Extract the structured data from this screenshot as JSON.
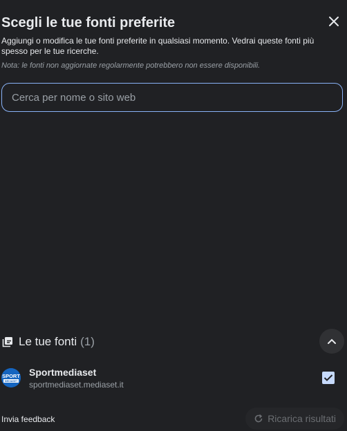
{
  "dialog": {
    "title": "Scegli le tue fonti preferite",
    "description": "Aggiungi o modifica le tue fonti preferite in qualsiasi momento. Vedrai queste fonti più spesso per le tue ricerche.",
    "note": "Nota: le fonti non aggiornate regolarmente potrebbero non essere disponibili.",
    "close_icon": "close-icon"
  },
  "search": {
    "placeholder": "Cerca per nome o sito web",
    "value": ""
  },
  "sources": {
    "title": "Le tue fonti",
    "count": "(1)",
    "items": [
      {
        "name": "Sportmediaset",
        "url": "sportmediaset.mediaset.it",
        "checked": true,
        "logo_top": "SPORT",
        "logo_bottom": "MEDIASET"
      }
    ]
  },
  "footer": {
    "feedback": "Invia feedback",
    "reload": "Ricarica risultati"
  },
  "colors": {
    "background": "#202124",
    "accent": "#8ab4f8",
    "checkbox": "#c6dafc"
  }
}
